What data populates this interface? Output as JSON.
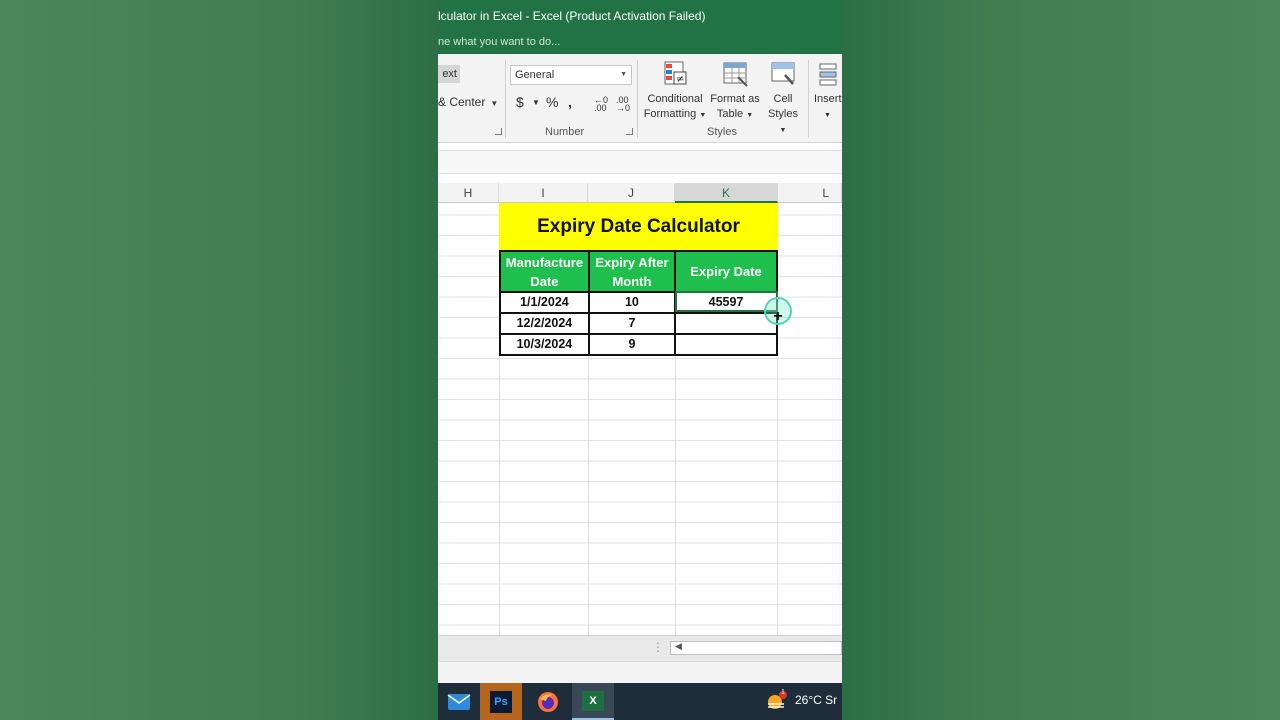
{
  "window": {
    "title": "lculator in Excel - Excel (Product Activation Failed)",
    "tell_me": "ne what you want to do..."
  },
  "ribbon": {
    "wrap_text_partial": "ext",
    "merge_center": "& Center",
    "number_format": "General",
    "currency_symbol": "$",
    "percent_symbol": "%",
    "comma_symbol": ",",
    "increase_decimal": "←0 .00",
    "decrease_decimal": ".00 →0",
    "group_number": "Number",
    "group_styles": "Styles",
    "conditional_formatting_line1": "Conditional",
    "conditional_formatting_line2": "Formatting",
    "format_as_table_line1": "Format as",
    "format_as_table_line2": "Table",
    "cell_styles_line1": "Cell",
    "cell_styles_line2": "Styles",
    "insert_partial": "Insert"
  },
  "columns": [
    "H",
    "I",
    "J",
    "K",
    "L"
  ],
  "selected_column": "K",
  "sheet": {
    "title": "Expiry Date Calculator",
    "headers": {
      "manufacture": "Manufacture Date",
      "expiry_after": "Expiry After Month",
      "expiry_date": "Expiry Date"
    },
    "rows": [
      {
        "manufacture": "1/1/2024",
        "months": "10",
        "expiry": "45597"
      },
      {
        "manufacture": "12/2/2024",
        "months": "7",
        "expiry": ""
      },
      {
        "manufacture": "10/3/2024",
        "months": "9",
        "expiry": ""
      }
    ]
  },
  "taskbar": {
    "apps": [
      "mail-icon",
      "photoshop-icon",
      "firefox-icon",
      "excel-icon"
    ],
    "photoshop_label": "Ps",
    "excel_label": "X",
    "weather_badge": "1",
    "temperature": "26°C  Sr"
  },
  "colors": {
    "excel_green": "#217346",
    "title_fill": "#ffff00",
    "header_fill": "#1fbf4d"
  }
}
